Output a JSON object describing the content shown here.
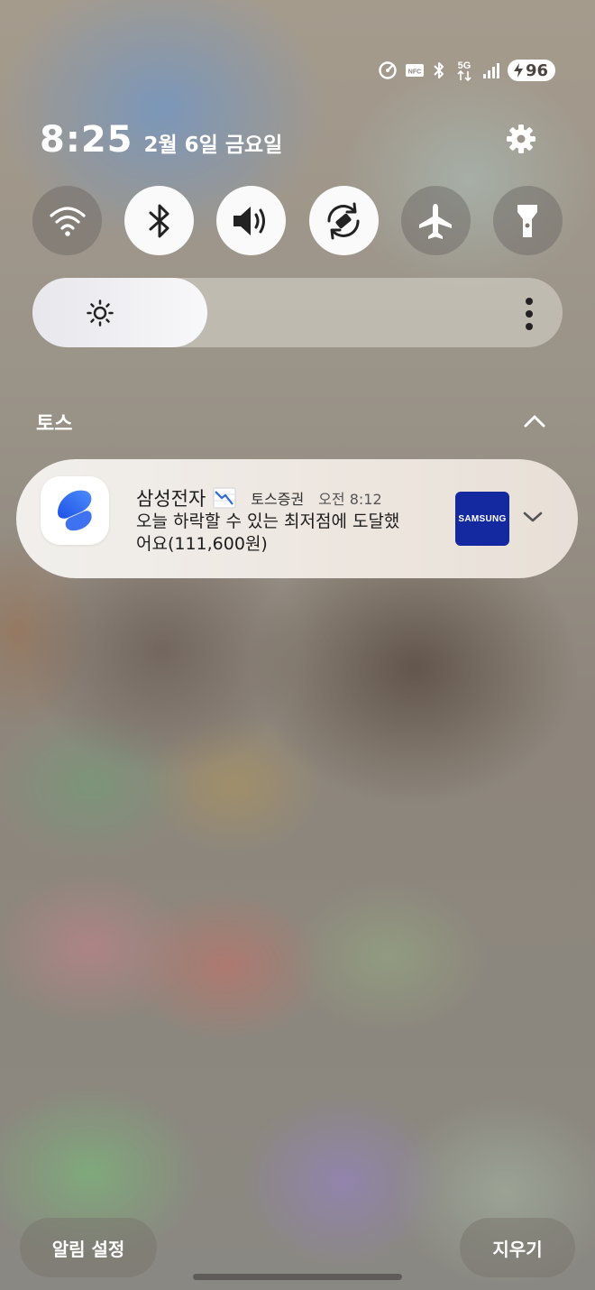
{
  "status_bar": {
    "icons": [
      "data-saver-icon",
      "nfc-icon",
      "bluetooth-icon",
      "5g-icon",
      "signal-icon"
    ],
    "nfc_label": "NFC",
    "network": "5G",
    "battery": "96"
  },
  "header": {
    "time": "8:25",
    "date": "2월 6일 금요일"
  },
  "quick_settings": {
    "tiles": [
      {
        "name": "wifi",
        "active": false
      },
      {
        "name": "bluetooth",
        "active": true
      },
      {
        "name": "sound",
        "active": true
      },
      {
        "name": "auto-rotate",
        "active": true
      },
      {
        "name": "airplane-mode",
        "active": false
      },
      {
        "name": "flashlight",
        "active": false
      }
    ],
    "brightness_level": 0.33
  },
  "notification_group": {
    "app_title": "토스",
    "notification": {
      "title": "삼성전자",
      "app_name": "토스증권",
      "time": "오전 8:12",
      "body": "오늘 하락할 수 있는 최저점에 도달했어요(111,600원)",
      "thumbnail_text": "SAMSUNG"
    }
  },
  "bottom": {
    "settings_label": "알림 설정",
    "clear_label": "지우기"
  },
  "colors": {
    "tile_on": "#fafafa",
    "tile_off": "#6a6460",
    "samsung_blue": "#1428a0",
    "toss_blue": "#2f6ef0"
  }
}
